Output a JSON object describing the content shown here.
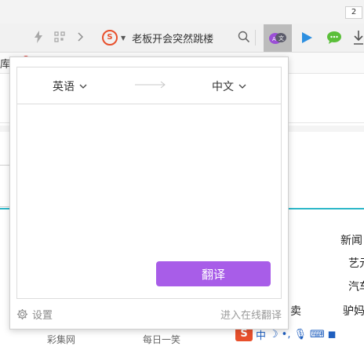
{
  "browser": {
    "tab_count": "2",
    "news_headline": "老板开会突然跳楼",
    "bookmark_fragment": "库"
  },
  "icons": {
    "lightning": "lightning-icon",
    "qr": "qr-code-icon",
    "forward": "chevron-right-icon",
    "search": "search-icon",
    "translate": "translate-icon",
    "video": "play-icon",
    "chat": "chat-icon",
    "download": "download-icon",
    "settings": "gear-icon"
  },
  "colors": {
    "accent": "#a85de8",
    "teal": "#2bb7c8",
    "sogou": "#e8502c"
  },
  "translator": {
    "source_lang": "英语",
    "target_lang": "中文",
    "input_value": "",
    "translate_label": "翻译",
    "settings_label": "设置",
    "online_label": "进入在线翻译"
  },
  "page": {
    "right_items": [
      "新闻",
      "艺元",
      "汽车",
      "驴妈"
    ],
    "mid_fragment": "卖",
    "bottom_left": "彩集网",
    "bottom_mid": "每日一笑"
  },
  "taskbar": {
    "ime_label": "中",
    "sogou_label": "S"
  }
}
